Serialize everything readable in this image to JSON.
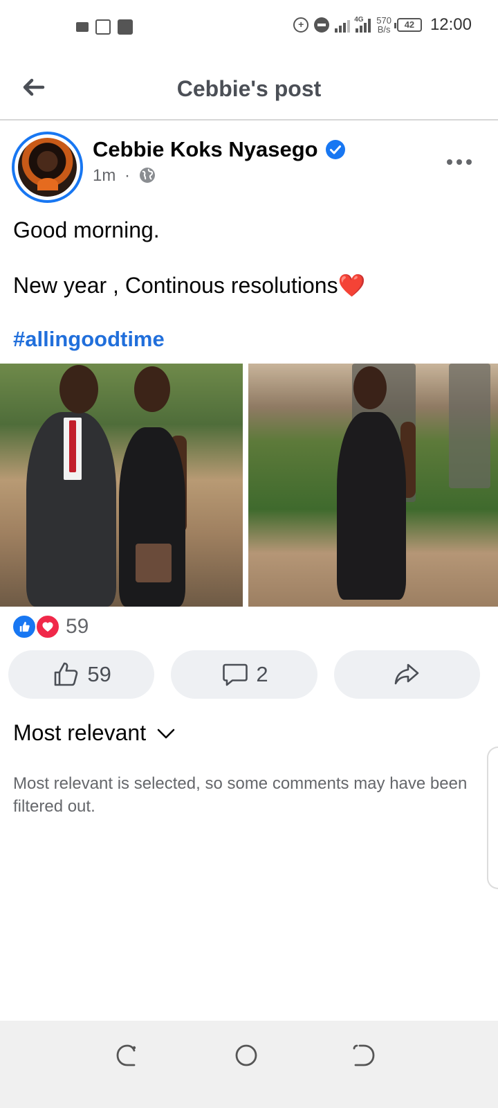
{
  "status_bar": {
    "net_speed_value": "570",
    "net_speed_unit": "B/s",
    "network_type": "4G",
    "battery": "42",
    "time": "12:00"
  },
  "header": {
    "title": "Cebbie's post"
  },
  "post": {
    "author": "Cebbie Koks Nyasego",
    "time": "1m",
    "separator": "·",
    "text_line_1": "Good morning.",
    "text_line_2": "New year , Continous resolutions",
    "text_emoji": "❤️",
    "hashtag": "#allingoodtime",
    "reaction_count": "59"
  },
  "actions": {
    "like_count": "59",
    "comment_count": "2"
  },
  "comments": {
    "sort_label": "Most relevant",
    "filter_note": "Most relevant is selected, so some comments may have been filtered out."
  },
  "colors": {
    "brand_blue": "#1877f2",
    "hashtag_blue": "#216fdb",
    "love_red": "#f02849",
    "button_bg": "#eef0f3"
  }
}
